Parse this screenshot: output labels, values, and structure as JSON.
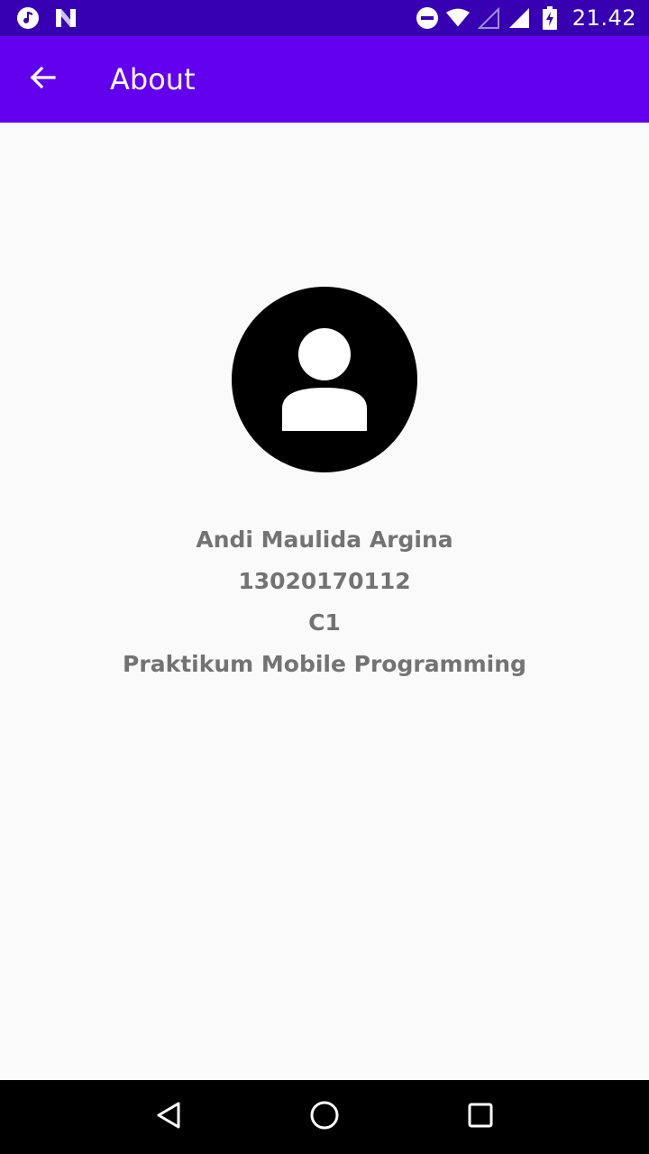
{
  "status_bar": {
    "time": "21.42",
    "left_icons": [
      "music-note-icon",
      "n-logo-icon"
    ],
    "right_icons": [
      "do-not-disturb-icon",
      "wifi-icon",
      "signal-empty-icon",
      "signal-icon",
      "battery-charging-icon"
    ]
  },
  "app_bar": {
    "title": "About",
    "back_icon": "arrow-back-icon",
    "background": "#6200ee"
  },
  "profile": {
    "avatar_icon": "account-circle-icon",
    "name": "Andi Maulida Argina",
    "student_id": "13020170112",
    "class": "C1",
    "course": "Praktikum Mobile Programming"
  },
  "nav_bar": {
    "buttons": [
      "back-triangle-icon",
      "home-circle-icon",
      "recents-square-icon"
    ]
  },
  "colors": {
    "status_bar": "#3700b3",
    "app_bar": "#6200ee",
    "text": "#737373",
    "background": "#fafafa"
  }
}
